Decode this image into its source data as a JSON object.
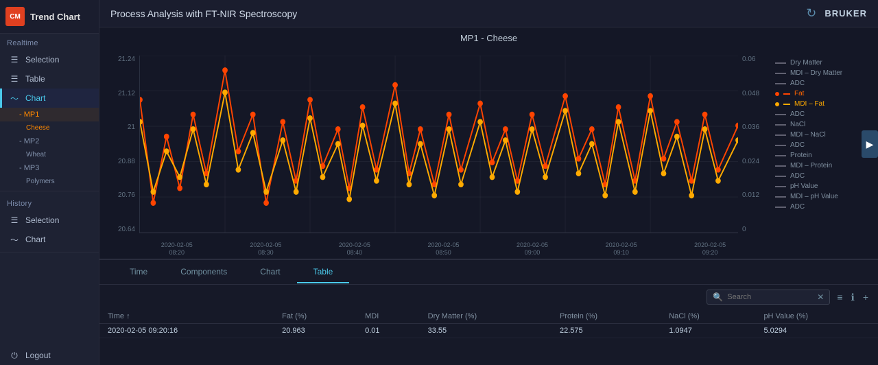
{
  "app": {
    "logo": "CM",
    "title": "Trend Chart",
    "logo_bg": "#e04020"
  },
  "header": {
    "title": "Process Analysis with FT-NIR Spectroscopy",
    "refresh_icon": "↺",
    "logo_icon": "B"
  },
  "sidebar": {
    "realtime_label": "Realtime",
    "items_realtime": [
      {
        "id": "realtime-selection",
        "label": "Selection",
        "icon": "☰",
        "active": false
      },
      {
        "id": "realtime-table",
        "label": "Table",
        "icon": "☰",
        "active": false
      },
      {
        "id": "realtime-chart",
        "label": "Chart",
        "icon": "∿",
        "active": true
      }
    ],
    "chart_sub": [
      {
        "id": "mp1-cheese",
        "label": "- MP1",
        "sub": "Cheese",
        "active": true,
        "highlighted": true
      },
      {
        "id": "mp2-wheat",
        "label": "- MP2",
        "sub": "Wheat",
        "active": false
      },
      {
        "id": "mp3-polymers",
        "label": "- MP3",
        "sub": "Polymers",
        "active": false
      }
    ],
    "history_label": "History",
    "items_history": [
      {
        "id": "history-selection",
        "label": "Selection",
        "icon": "☰",
        "active": false
      },
      {
        "id": "history-chart",
        "label": "Chart",
        "icon": "∿",
        "active": false
      }
    ],
    "logout": {
      "id": "logout",
      "label": "Logout",
      "icon": "⏻"
    }
  },
  "chart": {
    "title": "MP1 - Cheese",
    "y_left": [
      "21.24",
      "21.12",
      "21",
      "20.88",
      "20.76",
      "20.64"
    ],
    "y_right": [
      "0.06",
      "0.048",
      "0.036",
      "0.024",
      "0.012",
      "0"
    ],
    "x_labels": [
      {
        "date": "2020-02-05",
        "time": "08:20"
      },
      {
        "date": "2020-02-05",
        "time": "08:30"
      },
      {
        "date": "2020-02-05",
        "time": "08:40"
      },
      {
        "date": "2020-02-05",
        "time": "08:50"
      },
      {
        "date": "2020-02-05",
        "time": "09:00"
      },
      {
        "date": "2020-02-05",
        "time": "09:10"
      },
      {
        "date": "2020-02-05",
        "time": "09:20"
      }
    ],
    "legend": [
      {
        "label": "Dry Matter",
        "color": "#606070",
        "active": false
      },
      {
        "label": "MDI – Dry Matter",
        "color": "#606070",
        "active": false
      },
      {
        "label": "ADC",
        "color": "#606070",
        "active": false
      },
      {
        "label": "Fat",
        "color": "#ff4400",
        "active": true,
        "highlighted": true
      },
      {
        "label": "MDI – Fat",
        "color": "#ff8800",
        "active": true,
        "highlighted2": true
      },
      {
        "label": "ADC",
        "color": "#606070",
        "active": false
      },
      {
        "label": "NaCl",
        "color": "#606070",
        "active": false
      },
      {
        "label": "MDI – NaCl",
        "color": "#606070",
        "active": false
      },
      {
        "label": "ADC",
        "color": "#606070",
        "active": false
      },
      {
        "label": "Protein",
        "color": "#606070",
        "active": false
      },
      {
        "label": "MDI – Protein",
        "color": "#606070",
        "active": false
      },
      {
        "label": "ADC",
        "color": "#606070",
        "active": false
      },
      {
        "label": "pH Value",
        "color": "#606070",
        "active": false
      },
      {
        "label": "MDI – pH Value",
        "color": "#606070",
        "active": false
      },
      {
        "label": "ADC",
        "color": "#606070",
        "active": false
      }
    ]
  },
  "bottom": {
    "tabs": [
      {
        "label": "Time",
        "active": false
      },
      {
        "label": "Components",
        "active": false
      },
      {
        "label": "Chart",
        "active": false
      },
      {
        "label": "Table",
        "active": true
      }
    ],
    "search_placeholder": "Search",
    "table": {
      "columns": [
        "Time",
        "Fat (%)",
        "MDI",
        "Dry Matter (%)",
        "Protein (%)",
        "NaCl (%)",
        "pH Value (%)"
      ],
      "rows": [
        [
          "2020-02-05 09:20:16",
          "20.963",
          "0.01",
          "33.55",
          "22.575",
          "1.0947",
          "5.0294"
        ]
      ]
    }
  }
}
